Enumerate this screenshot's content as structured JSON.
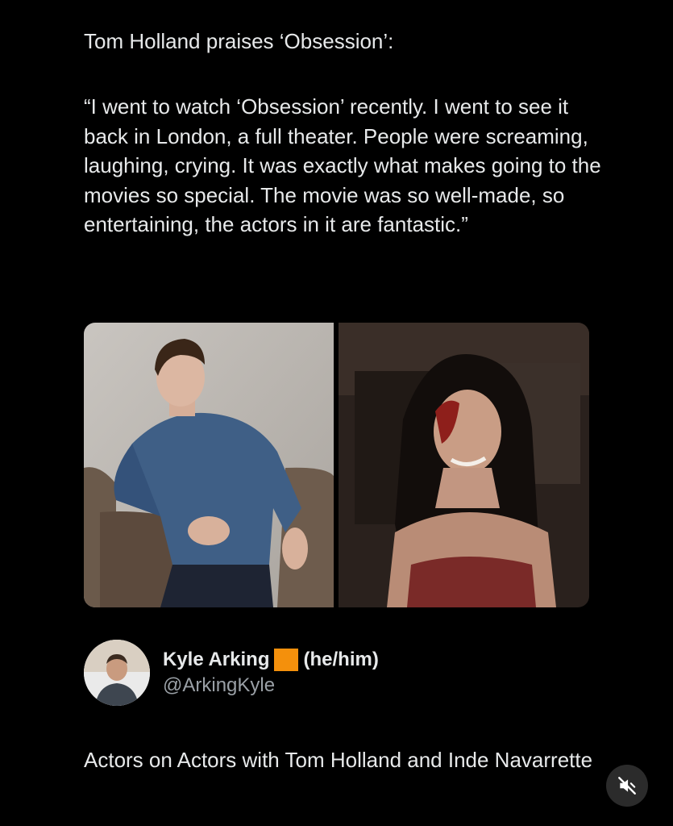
{
  "post": {
    "header": "Tom Holland praises ‘Obsession’:",
    "quote": "“I went to watch ‘Obsession’ recently. I went to see it back in London, a full theater. People were screaming, laughing, crying. It was exactly what makes going to the movies so special. The movie was so well-made, so entertaining, the actors in it are fantastic.”"
  },
  "media": {
    "left_photo_icon": "person-photo",
    "right_photo_icon": "film-still"
  },
  "author": {
    "name": "Kyle Arking",
    "badge_color": "#f4900c",
    "pronouns": "(he/him)",
    "handle": "@ArkingKyle"
  },
  "caption": "Actors on Actors with Tom Holland and Inde Navarrette",
  "controls": {
    "mute_icon": "volume-muted-icon"
  },
  "colors": {
    "background": "#000000",
    "text": "#e7e9ea",
    "secondary_text": "#9aa0a6",
    "badge": "#f4900c"
  }
}
